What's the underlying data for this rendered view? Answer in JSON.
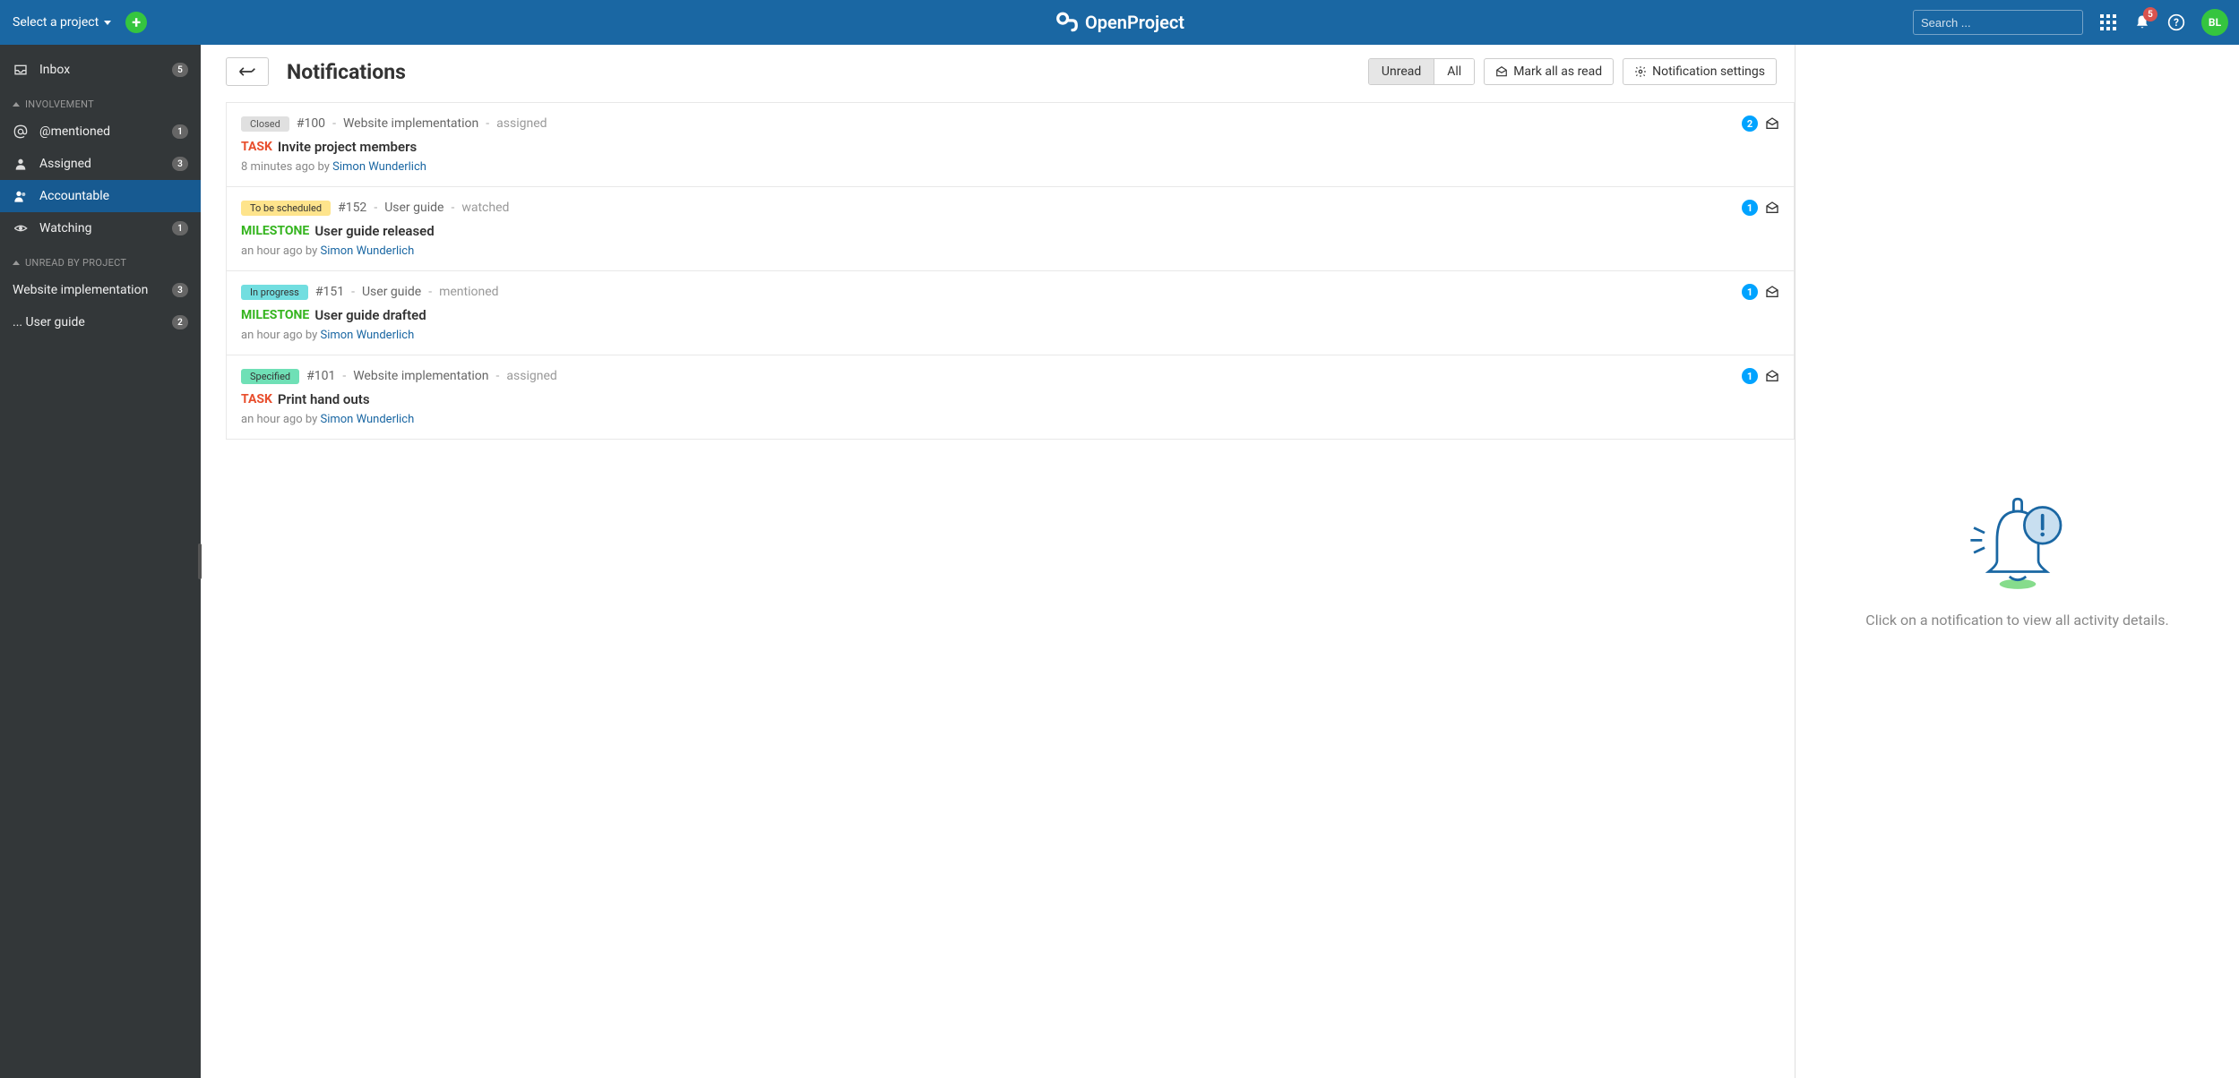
{
  "header": {
    "project_select": "Select a project",
    "logo_text": "OpenProject",
    "search_placeholder": "Search ...",
    "notif_badge": "5",
    "user_initials": "BL"
  },
  "sidebar": {
    "inbox_label": "Inbox",
    "inbox_count": "5",
    "section_involvement": "Involvement",
    "mentioned_label": "@mentioned",
    "mentioned_count": "1",
    "assigned_label": "Assigned",
    "assigned_count": "3",
    "accountable_label": "Accountable",
    "watching_label": "Watching",
    "watching_count": "1",
    "section_unread": "Unread by project",
    "proj1_label": "Website implementation",
    "proj1_count": "3",
    "proj2_label": "... User guide",
    "proj2_count": "2"
  },
  "toolbar": {
    "title": "Notifications",
    "seg_unread": "Unread",
    "seg_all": "All",
    "mark_all": "Mark all as read",
    "settings": "Notification settings"
  },
  "notifications": [
    {
      "status": "Closed",
      "status_class": "status-closed",
      "id": "#100",
      "project": "Website implementation",
      "reason": "assigned",
      "type": "TASK",
      "type_class": "type-task",
      "title": "Invite project members",
      "time": "8 minutes ago by",
      "author": "Simon Wunderlich",
      "count": "2"
    },
    {
      "status": "To be scheduled",
      "status_class": "status-scheduled",
      "id": "#152",
      "project": "User guide",
      "reason": "watched",
      "type": "MILESTONE",
      "type_class": "type-milestone",
      "title": "User guide released",
      "time": "an hour ago by",
      "author": "Simon Wunderlich",
      "count": "1"
    },
    {
      "status": "In progress",
      "status_class": "status-progress",
      "id": "#151",
      "project": "User guide",
      "reason": "mentioned",
      "type": "MILESTONE",
      "type_class": "type-milestone",
      "title": "User guide drafted",
      "time": "an hour ago by",
      "author": "Simon Wunderlich",
      "count": "1"
    },
    {
      "status": "Specified",
      "status_class": "status-specified",
      "id": "#101",
      "project": "Website implementation",
      "reason": "assigned",
      "type": "TASK",
      "type_class": "type-task",
      "title": "Print hand outs",
      "time": "an hour ago by",
      "author": "Simon Wunderlich",
      "count": "1"
    }
  ],
  "detail": {
    "empty_text": "Click on a notification to view all activity details."
  }
}
